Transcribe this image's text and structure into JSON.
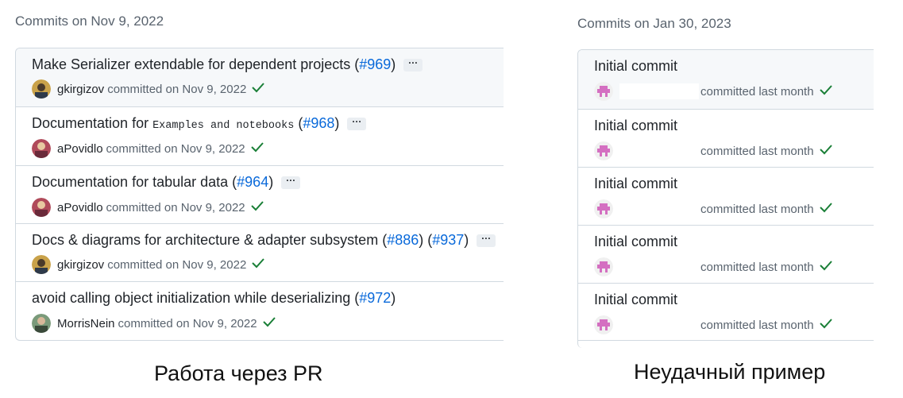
{
  "left": {
    "heading": "Commits on Nov 9, 2022",
    "commits": [
      {
        "title": "Make Serializer extendable for dependent projects ",
        "code": "",
        "after": "",
        "pr1": "#969",
        "pr2": "",
        "author": "gkirgizov",
        "committed": "committed on Nov 9, 2022",
        "ellipsis": "···"
      },
      {
        "title": "Documentation for ",
        "code": "Examples and notebooks",
        "after": " ",
        "pr1": "#968",
        "pr2": "",
        "author": "aPovidlo",
        "committed": "committed on Nov 9, 2022",
        "ellipsis": "···"
      },
      {
        "title": "Documentation for tabular data ",
        "code": "",
        "after": "",
        "pr1": "#964",
        "pr2": "",
        "author": "aPovidlo",
        "committed": "committed on Nov 9, 2022",
        "ellipsis": "···"
      },
      {
        "title": "Docs & diagrams for architecture & adapter subsystem ",
        "code": "",
        "after": "",
        "pr1": "#886",
        "pr2": "#937",
        "author": "gkirgizov",
        "committed": "committed on Nov 9, 2022",
        "ellipsis": "···"
      },
      {
        "title": "avoid calling object initialization while deserializing ",
        "code": "",
        "after": "",
        "pr1": "#972",
        "pr2": "",
        "author": "MorrisNein",
        "committed": "committed on Nov 9, 2022",
        "ellipsis": ""
      }
    ],
    "caption": "Работа через PR"
  },
  "right": {
    "heading": "Commits on Jan 30, 2023",
    "commits": [
      {
        "title": "Initial commit",
        "committed": "committed last month"
      },
      {
        "title": "Initial commit",
        "committed": "committed last month"
      },
      {
        "title": "Initial commit",
        "committed": "committed last month"
      },
      {
        "title": "Initial commit",
        "committed": "committed last month"
      },
      {
        "title": "Initial commit",
        "committed": "committed last month"
      }
    ],
    "caption": "Неудачный пример"
  },
  "colors": {
    "link": "#0969da",
    "check": "#1a7f37",
    "muted": "#59636e",
    "identicon": "#d46fc1"
  },
  "icons": {
    "check": "check-icon",
    "avatar": "avatar",
    "identicon": "identicon-avatar"
  }
}
